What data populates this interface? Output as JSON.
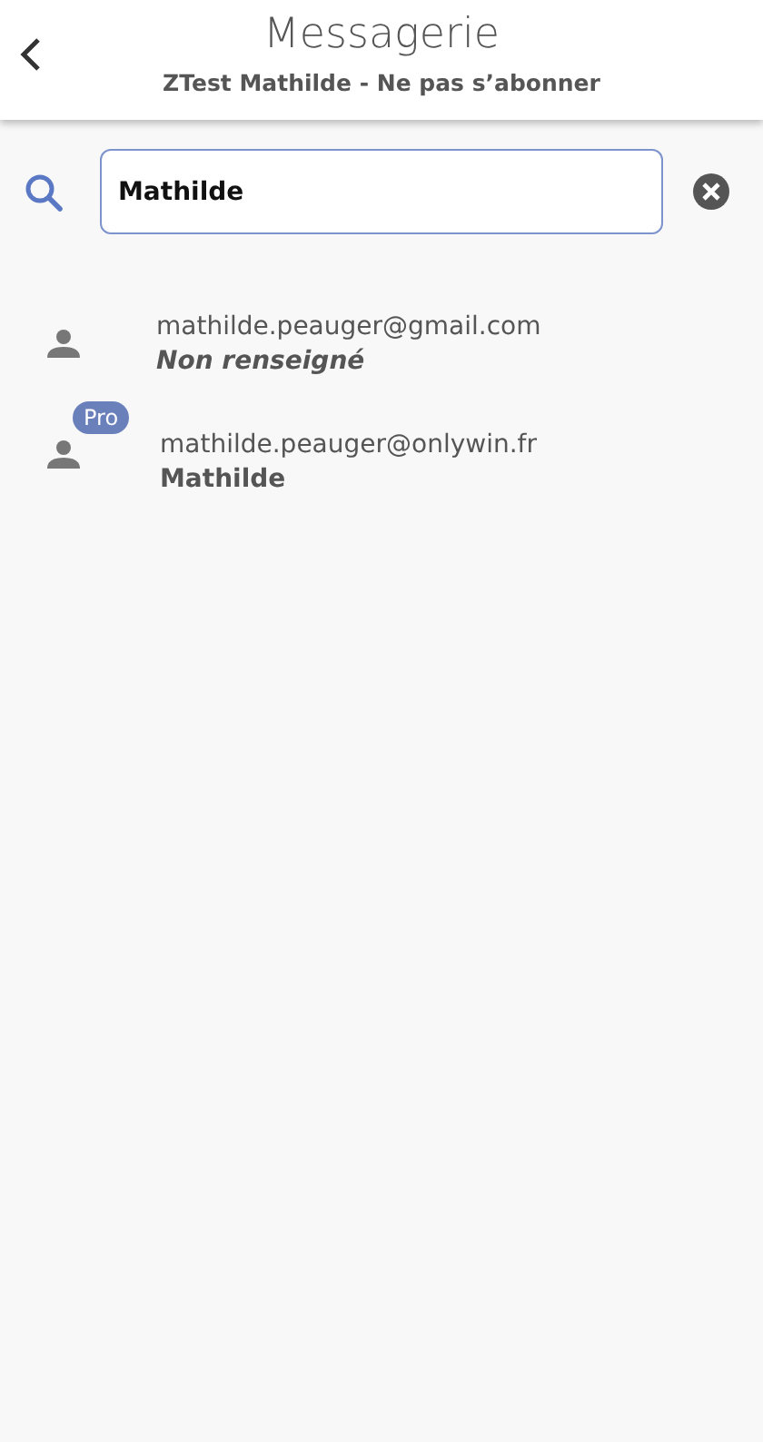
{
  "header": {
    "title": "Messagerie",
    "subtitle": "ZTest Mathilde - Ne pas s’abonner"
  },
  "search": {
    "value": "Mathilde"
  },
  "results": [
    {
      "email": "mathilde.peauger@gmail.com",
      "name": "Non renseigné",
      "kind": "unset"
    },
    {
      "email": "mathilde.peauger@onlywin.fr",
      "name": "Mathilde",
      "kind": "named",
      "badge": "Pro"
    }
  ]
}
